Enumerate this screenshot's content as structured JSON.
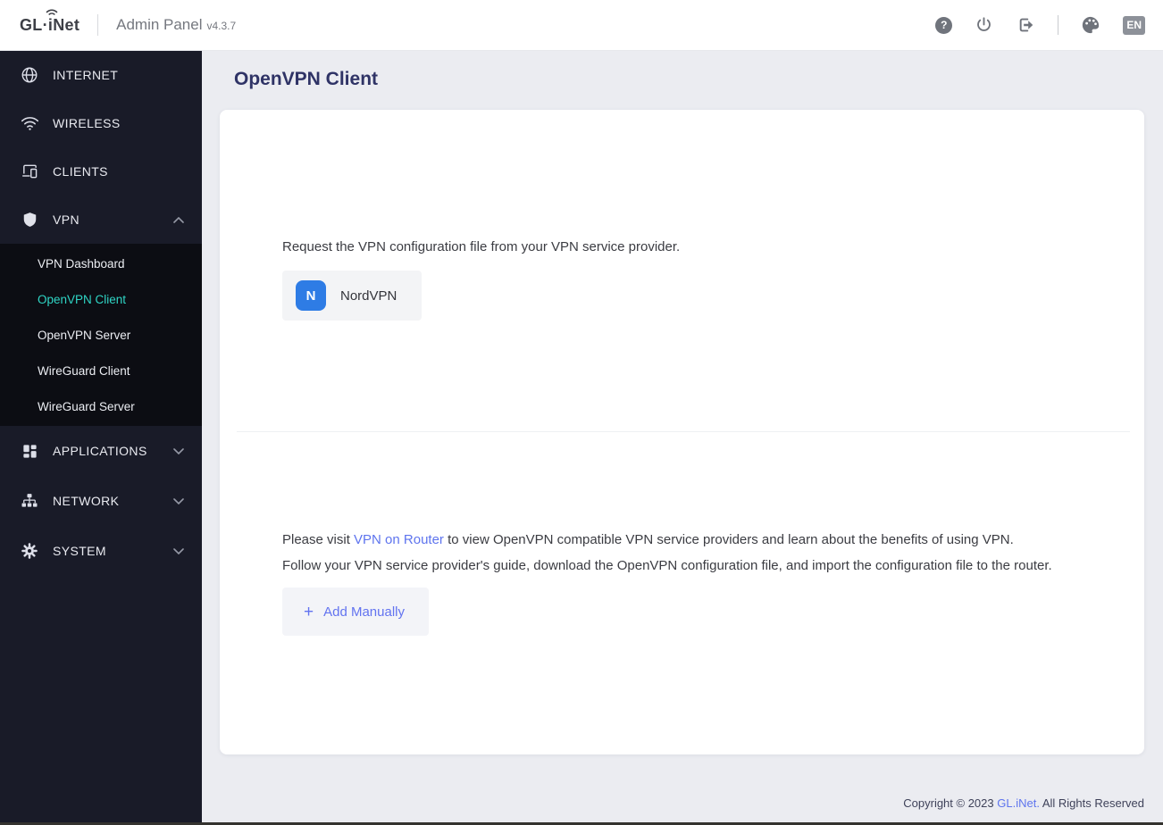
{
  "header": {
    "logo": {
      "part1": "GL·",
      "part2": "i",
      "part3": "Net"
    },
    "title": "Admin Panel",
    "version": "v4.3.7",
    "help_glyph": "?",
    "language_badge": "EN",
    "icons": {
      "help": "question-mark-circle",
      "power": "power-symbol",
      "logout": "logout-arrow",
      "theme": "color-palette",
      "language": "EN"
    }
  },
  "sidebar": {
    "items": [
      {
        "label": "INTERNET",
        "icon": "globe-icon"
      },
      {
        "label": "WIRELESS",
        "icon": "wifi-icon"
      },
      {
        "label": "CLIENTS",
        "icon": "devices-icon"
      },
      {
        "label": "VPN",
        "icon": "shield-icon",
        "expanded": true
      },
      {
        "label": "APPLICATIONS",
        "icon": "grid-icon",
        "expanded": false
      },
      {
        "label": "NETWORK",
        "icon": "network-icon",
        "expanded": false
      },
      {
        "label": "SYSTEM",
        "icon": "gear-icon",
        "expanded": false
      }
    ],
    "vpn_submenu": [
      {
        "label": "VPN Dashboard",
        "active": false
      },
      {
        "label": "OpenVPN Client",
        "active": true
      },
      {
        "label": "OpenVPN Server",
        "active": false
      },
      {
        "label": "WireGuard Client",
        "active": false
      },
      {
        "label": "WireGuard Server",
        "active": false
      }
    ],
    "active_item": "OpenVPN Client",
    "active_color": "#2fd5c5"
  },
  "main": {
    "page_title": "OpenVPN Client",
    "provider_section": {
      "instruction": "Request the VPN configuration file from your VPN service provider.",
      "providers": [
        {
          "name": "NordVPN",
          "initial": "N",
          "brand_color": "#2e7ce5"
        }
      ]
    },
    "manual_section": {
      "line1_prefix": "Please visit ",
      "line1_link": "VPN on Router",
      "line1_suffix": " to view OpenVPN compatible VPN service providers and learn about the benefits of using VPN.",
      "line2": "Follow your VPN service provider's guide, download the OpenVPN configuration file, and import the configuration file to the router.",
      "add_button_label": "Add Manually",
      "add_button_plus": "+"
    }
  },
  "footer": {
    "copyright_prefix": "Copyright © 2023 ",
    "copyright_link": "GL.iNet.",
    "copyright_suffix": " All Rights Reserved"
  },
  "colors": {
    "sidebar_bg": "#191b28",
    "submenu_bg": "#0c0d13",
    "page_bg": "#ebecf1",
    "accent_teal": "#2fd5c5",
    "link_blue": "#5e74ee",
    "nordvpn_blue": "#2e7ce5",
    "title_navy": "#2f3366"
  }
}
